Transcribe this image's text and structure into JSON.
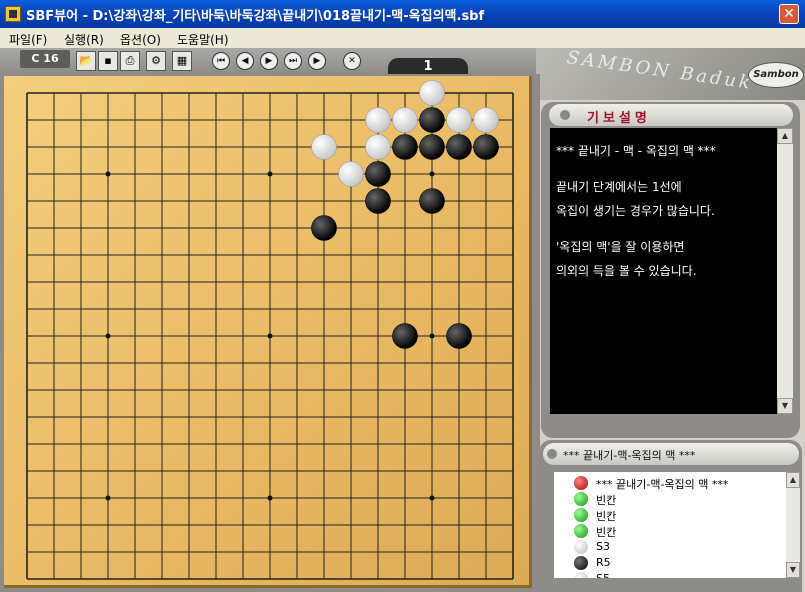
{
  "window": {
    "title": "SBF뷰어 - D:\\강좌\\강좌_기타\\바둑\\바둑강좌\\끝내기\\018끝내기-맥-옥집의맥.sbf",
    "close_label": "✕"
  },
  "menu": [
    {
      "label": "파일(F)"
    },
    {
      "label": "실행(R)"
    },
    {
      "label": "옵션(O)"
    },
    {
      "label": "도움말(H)"
    }
  ],
  "toolbar": {
    "coordinate": "C 16",
    "move_number": "1",
    "icons": [
      "open-folder-icon",
      "save-icon",
      "print-icon",
      "printer-setup-icon",
      "grid-icon"
    ],
    "nav": [
      {
        "name": "first-move-icon",
        "glyph": "⏮"
      },
      {
        "name": "prev-move-icon",
        "glyph": "◀"
      },
      {
        "name": "next-move-icon",
        "glyph": "▶"
      },
      {
        "name": "last-move-icon",
        "glyph": "⏭"
      },
      {
        "name": "play-icon",
        "glyph": "▶"
      },
      {
        "name": "stop-icon",
        "glyph": "✕"
      }
    ]
  },
  "brand": {
    "main": "SAMBON Baduk",
    "badge": "Sambon"
  },
  "board": {
    "size": 19,
    "stones": [
      {
        "c": 15,
        "r": 0,
        "color": "white"
      },
      {
        "c": 13,
        "r": 1,
        "color": "white"
      },
      {
        "c": 14,
        "r": 1,
        "color": "white"
      },
      {
        "c": 15,
        "r": 1,
        "color": "black"
      },
      {
        "c": 16,
        "r": 1,
        "color": "white"
      },
      {
        "c": 17,
        "r": 1,
        "color": "white"
      },
      {
        "c": 11,
        "r": 2,
        "color": "white"
      },
      {
        "c": 13,
        "r": 2,
        "color": "white"
      },
      {
        "c": 14,
        "r": 2,
        "color": "black"
      },
      {
        "c": 15,
        "r": 2,
        "color": "black"
      },
      {
        "c": 16,
        "r": 2,
        "color": "black"
      },
      {
        "c": 17,
        "r": 2,
        "color": "black"
      },
      {
        "c": 12,
        "r": 3,
        "color": "white"
      },
      {
        "c": 13,
        "r": 3,
        "color": "black"
      },
      {
        "c": 13,
        "r": 4,
        "color": "black"
      },
      {
        "c": 15,
        "r": 4,
        "color": "black"
      },
      {
        "c": 11,
        "r": 5,
        "color": "black"
      },
      {
        "c": 14,
        "r": 9,
        "color": "black"
      },
      {
        "c": 16,
        "r": 9,
        "color": "black"
      }
    ]
  },
  "comment": {
    "header": "기보설명",
    "lines": [
      "*** 끝내기 - 맥 - 옥집의 맥 ***",
      "",
      "끝내기 단계에서는 1선에",
      "옥집이 생기는 경우가 많습니다.",
      "",
      "'옥집의 맥'을 잘 이용하면",
      "의외의 득을 볼 수 있습니다."
    ]
  },
  "tree": {
    "header": "*** 끝내기-맥-옥집의 맥 ***",
    "items": [
      {
        "label": "*** 끝내기-맥-옥집의 맥 ***",
        "kind": "red"
      },
      {
        "label": "빈칸",
        "kind": "green"
      },
      {
        "label": "빈칸",
        "kind": "green"
      },
      {
        "label": "빈칸",
        "kind": "green"
      },
      {
        "label": "S3",
        "kind": "white"
      },
      {
        "label": "R5",
        "kind": "black"
      },
      {
        "label": "S5",
        "kind": "white"
      }
    ]
  },
  "colors": {
    "title_bar": "#0842b8",
    "board": "#e8b863",
    "comment_header_text": "#a0152a"
  }
}
